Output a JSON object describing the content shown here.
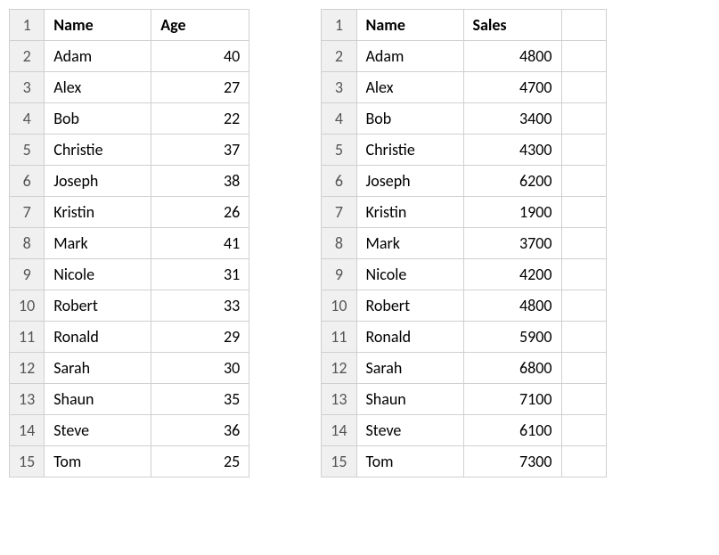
{
  "tableLeft": {
    "headers": {
      "col1": "Name",
      "col2": "Age"
    },
    "rows": [
      {
        "name": "Adam",
        "val": "40"
      },
      {
        "name": "Alex",
        "val": "27"
      },
      {
        "name": "Bob",
        "val": "22"
      },
      {
        "name": "Christie",
        "val": "37"
      },
      {
        "name": "Joseph",
        "val": "38"
      },
      {
        "name": "Kristin",
        "val": "26"
      },
      {
        "name": "Mark",
        "val": "41"
      },
      {
        "name": "Nicole",
        "val": "31"
      },
      {
        "name": "Robert",
        "val": "33"
      },
      {
        "name": "Ronald",
        "val": "29"
      },
      {
        "name": "Sarah",
        "val": "30"
      },
      {
        "name": "Shaun",
        "val": "35"
      },
      {
        "name": "Steve",
        "val": "36"
      },
      {
        "name": "Tom",
        "val": "25"
      }
    ]
  },
  "tableRight": {
    "headers": {
      "col1": "Name",
      "col2": "Sales"
    },
    "rows": [
      {
        "name": "Adam",
        "val": "4800"
      },
      {
        "name": "Alex",
        "val": "4700"
      },
      {
        "name": "Bob",
        "val": "3400"
      },
      {
        "name": "Christie",
        "val": "4300"
      },
      {
        "name": "Joseph",
        "val": "6200"
      },
      {
        "name": "Kristin",
        "val": "1900"
      },
      {
        "name": "Mark",
        "val": "3700"
      },
      {
        "name": "Nicole",
        "val": "4200"
      },
      {
        "name": "Robert",
        "val": "4800"
      },
      {
        "name": "Ronald",
        "val": "5900"
      },
      {
        "name": "Sarah",
        "val": "6800"
      },
      {
        "name": "Shaun",
        "val": "7100"
      },
      {
        "name": "Steve",
        "val": "6100"
      },
      {
        "name": "Tom",
        "val": "7300"
      }
    ]
  },
  "rowNumbers": [
    "1",
    "2",
    "3",
    "4",
    "5",
    "6",
    "7",
    "8",
    "9",
    "10",
    "11",
    "12",
    "13",
    "14",
    "15"
  ]
}
